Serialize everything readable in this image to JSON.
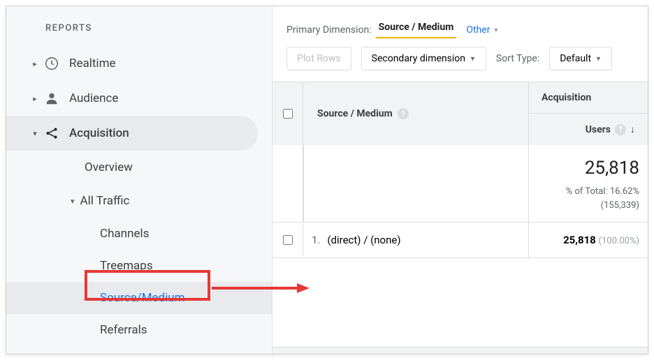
{
  "sidebar": {
    "header": "REPORTS",
    "items": [
      {
        "label": "Realtime",
        "expanded": false
      },
      {
        "label": "Audience",
        "expanded": false
      },
      {
        "label": "Acquisition",
        "expanded": true,
        "active": true,
        "children": [
          {
            "label": "Overview"
          },
          {
            "label": "All Traffic",
            "expanded": true,
            "children": [
              {
                "label": "Channels"
              },
              {
                "label": "Treemaps"
              },
              {
                "label": "Source/Medium",
                "highlighted": true
              },
              {
                "label": "Referrals"
              }
            ]
          }
        ]
      }
    ]
  },
  "main": {
    "primary_dimension_label": "Primary Dimension:",
    "primary_dimension_active": "Source / Medium",
    "other_label": "Other",
    "plot_rows": "Plot Rows",
    "secondary_dimension": "Secondary dimension",
    "sort_type_label": "Sort Type:",
    "sort_type_value": "Default",
    "table": {
      "column_sm": "Source / Medium",
      "acq_group": "Acquisition",
      "users_header": "Users",
      "total_users": "25,818",
      "pct_of_total_label": "% of Total:",
      "pct_of_total_value": "16.62%",
      "grand_total": "(155,339)",
      "rows": [
        {
          "rank": "1.",
          "source_medium": "(direct) / (none)",
          "users": "25,818",
          "pct": "(100.00%)"
        }
      ]
    }
  }
}
